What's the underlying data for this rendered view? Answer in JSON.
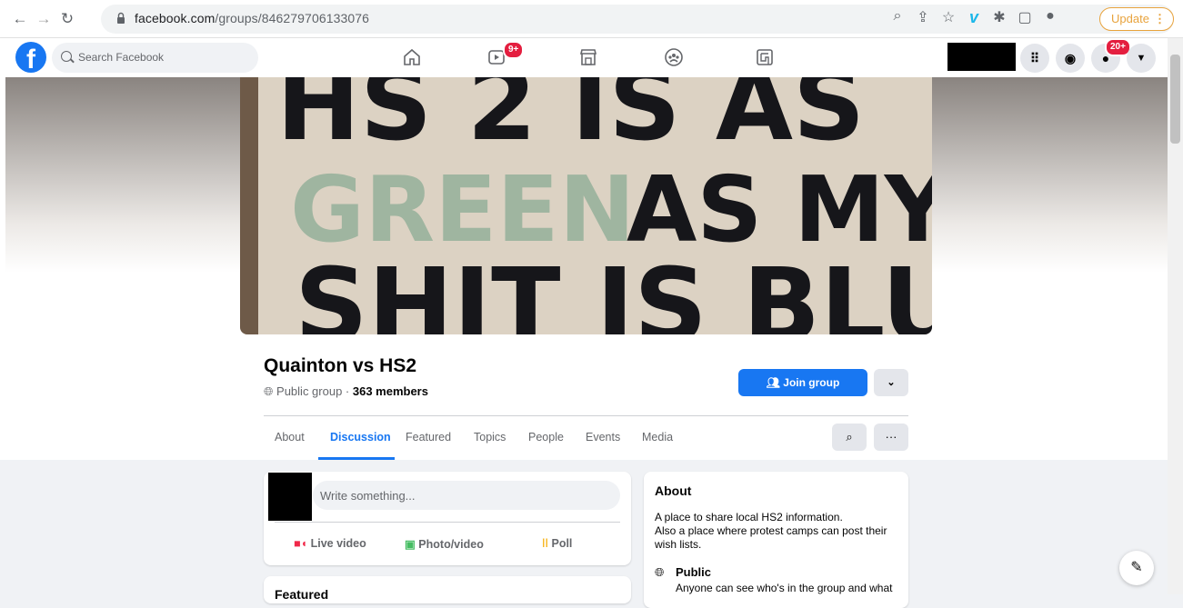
{
  "browser": {
    "url_host": "facebook.com",
    "url_path": "/groups/846279706133076",
    "update_label": "Update"
  },
  "facebook": {
    "search_placeholder": "Search Facebook",
    "watch_badge": "9+",
    "notifications_badge": "20+"
  },
  "cover": {
    "banner_line1": "HS 2 IS AS",
    "banner_line2_green": "GREEN",
    "banner_line2_rest": "AS MY",
    "banner_line3": "SHIT IS BLUE"
  },
  "group": {
    "name": "Quainton vs HS2",
    "privacy": "Public group · ",
    "members": "363 members",
    "join_label": "Join group"
  },
  "tabs": [
    "About",
    "Discussion",
    "Featured",
    "Topics",
    "People",
    "Events",
    "Media"
  ],
  "composer": {
    "placeholder": "Write something...",
    "actions": [
      "Live video",
      "Photo/video",
      "Poll"
    ]
  },
  "about": {
    "title": "About",
    "description_line1": "A place to share local HS2 information.",
    "description_line2": "Also a place where protest camps can post their",
    "description_line3": "wish lists.",
    "public_title": "Public",
    "public_sub": "Anyone can see who's in the group and what"
  },
  "featured_title": "Featured",
  "colors": {
    "accent": "#1877f2",
    "badge": "#e41e3f",
    "update": "#e8a33d"
  }
}
